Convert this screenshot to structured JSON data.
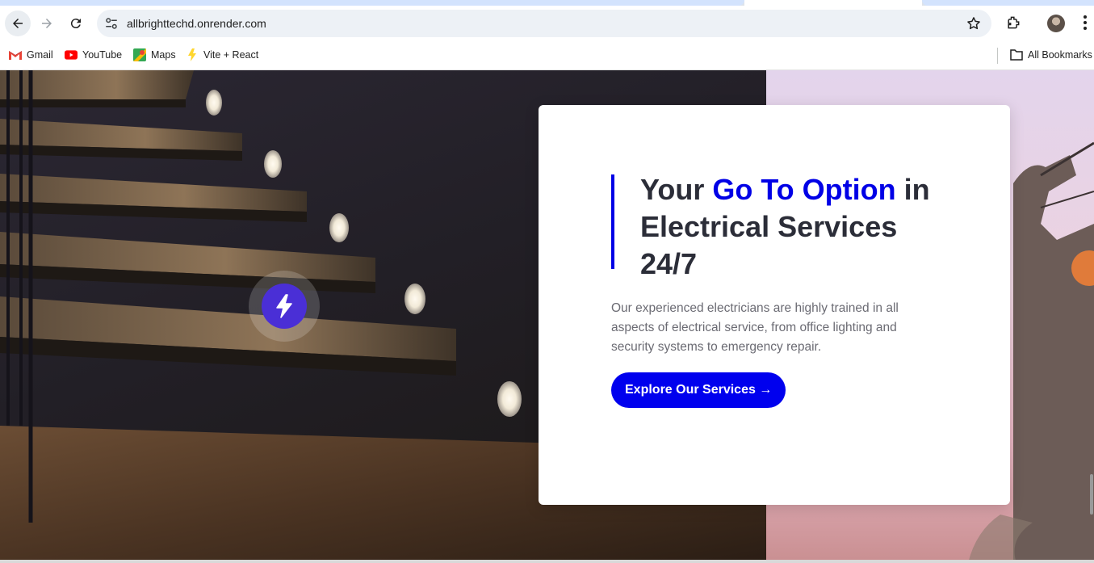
{
  "browser": {
    "url": "allbrighttechd.onrender.com",
    "bookmarks": [
      {
        "label": "Gmail",
        "icon": "gmail-icon"
      },
      {
        "label": "YouTube",
        "icon": "youtube-icon"
      },
      {
        "label": "Maps",
        "icon": "maps-icon"
      },
      {
        "label": "Vite + React",
        "icon": "vite-icon"
      }
    ],
    "all_bookmarks_label": "All Bookmarks"
  },
  "hero": {
    "headline_prefix": "Your ",
    "headline_highlight": "Go To Option",
    "headline_suffix": " in Electrical Services 24/7",
    "description": "Our experienced electricians are highly trained in all aspects of electrical service, from office lighting and security systems to emergency repair.",
    "cta_label": "Explore Our Services →",
    "badge_icon": "lightning-bolt-icon"
  },
  "colors": {
    "accent": "#0000ee",
    "heading": "#2b2d38",
    "body_text": "#6b6b73",
    "badge": "#4a2fd6"
  }
}
